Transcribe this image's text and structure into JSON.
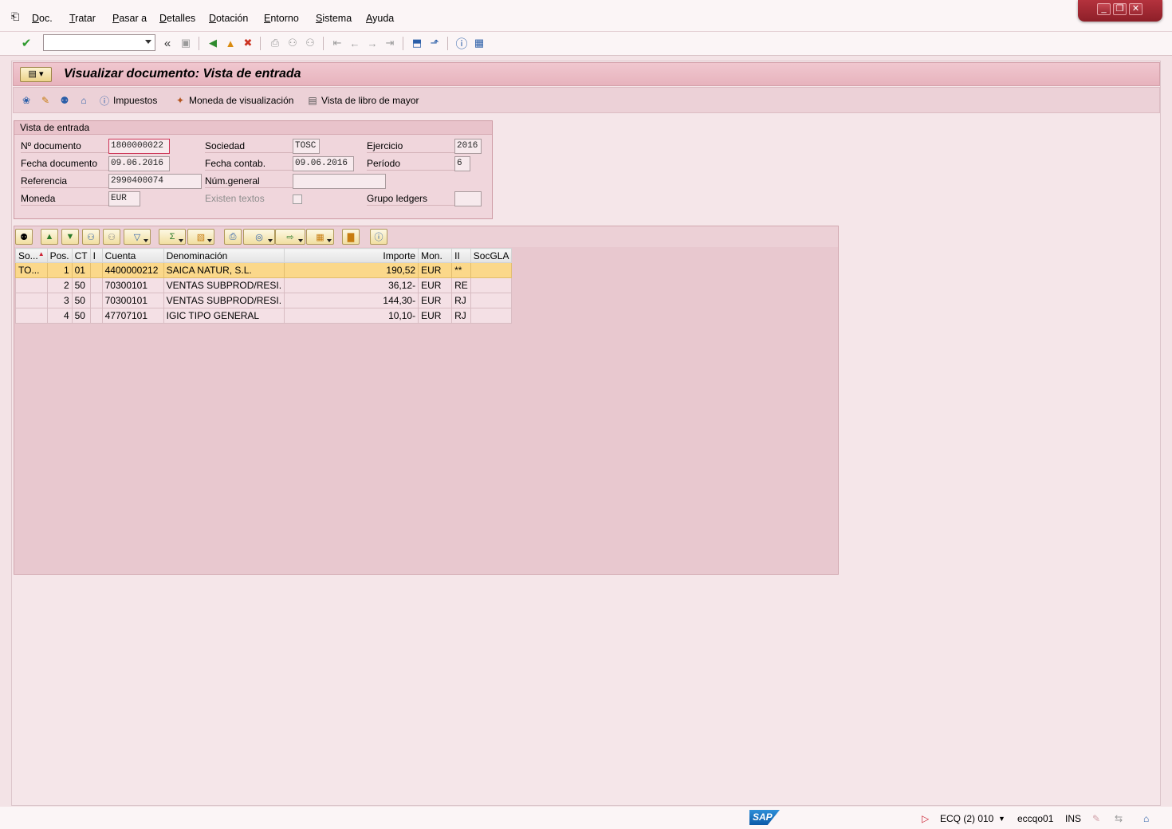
{
  "menu": {
    "items": [
      {
        "label": "Doc.",
        "u": "D"
      },
      {
        "label": "Tratar",
        "u": "T"
      },
      {
        "label": "Pasar a",
        "u": "P"
      },
      {
        "label": "Detalles",
        "u": "D"
      },
      {
        "label": "Dotación",
        "u": "D"
      },
      {
        "label": "Entorno",
        "u": "E"
      },
      {
        "label": "Sistema",
        "u": "S"
      },
      {
        "label": "Ayuda",
        "u": "A"
      }
    ]
  },
  "window": {
    "minimize": "_",
    "restore": "❐",
    "close": "✕"
  },
  "toolbar": {
    "command_field": "",
    "back_chevron": "«"
  },
  "page": {
    "title": "Visualizar documento: Vista de entrada"
  },
  "app_toolbar": {
    "taxes_label": "Impuestos",
    "display_currency_label": "Moneda de visualización",
    "ledger_view_label": "Vista de libro de mayor"
  },
  "entry_view": {
    "title": "Vista de entrada",
    "doc_number_label": "Nº documento",
    "doc_number": "1800000022",
    "company_label": "Sociedad",
    "company": "TOSC",
    "fiscal_year_label": "Ejercicio",
    "fiscal_year": "2016",
    "doc_date_label": "Fecha documento",
    "doc_date": "09.06.2016",
    "posting_date_label": "Fecha contab.",
    "posting_date": "09.06.2016",
    "period_label": "Período",
    "period": "6",
    "reference_label": "Referencia",
    "reference": "2990400074",
    "general_num_label": "Núm.general",
    "general_num": "",
    "currency_label": "Moneda",
    "currency": "EUR",
    "texts_label": "Existen textos",
    "ledger_group_label": "Grupo ledgers",
    "ledger_group": ""
  },
  "grid": {
    "columns": [
      "So...",
      "Pos.",
      "CT",
      "I",
      "Cuenta",
      "Denominación",
      "Importe",
      "Mon.",
      "II",
      "SocGLA"
    ],
    "rows": [
      {
        "so": "TO...",
        "pos": "1",
        "ct": "01",
        "i": "",
        "cuenta": "4400000212",
        "denom": "SAICA NATUR, S.L.",
        "importe": "190,52",
        "mon": "EUR",
        "ii": "**",
        "socgla": ""
      },
      {
        "so": "",
        "pos": "2",
        "ct": "50",
        "i": "",
        "cuenta": "70300101",
        "denom": "VENTAS SUBPROD/RESI.",
        "importe": "36,12-",
        "mon": "EUR",
        "ii": "RE",
        "socgla": ""
      },
      {
        "so": "",
        "pos": "3",
        "ct": "50",
        "i": "",
        "cuenta": "70300101",
        "denom": "VENTAS SUBPROD/RESI.",
        "importe": "144,30-",
        "mon": "EUR",
        "ii": "RJ",
        "socgla": ""
      },
      {
        "so": "",
        "pos": "4",
        "ct": "50",
        "i": "",
        "cuenta": "47707101",
        "denom": "IGIC TIPO GENERAL",
        "importe": "10,10-",
        "mon": "EUR",
        "ii": "RJ",
        "socgla": ""
      }
    ]
  },
  "status": {
    "sap_logo": "SAP",
    "system": "ECQ (2) 010",
    "user": "eccqo01",
    "mode": "INS"
  },
  "colors": {
    "accent": "#b4323d",
    "title_bar": "#e7b3bd",
    "selected_row": "#fbd88a"
  }
}
